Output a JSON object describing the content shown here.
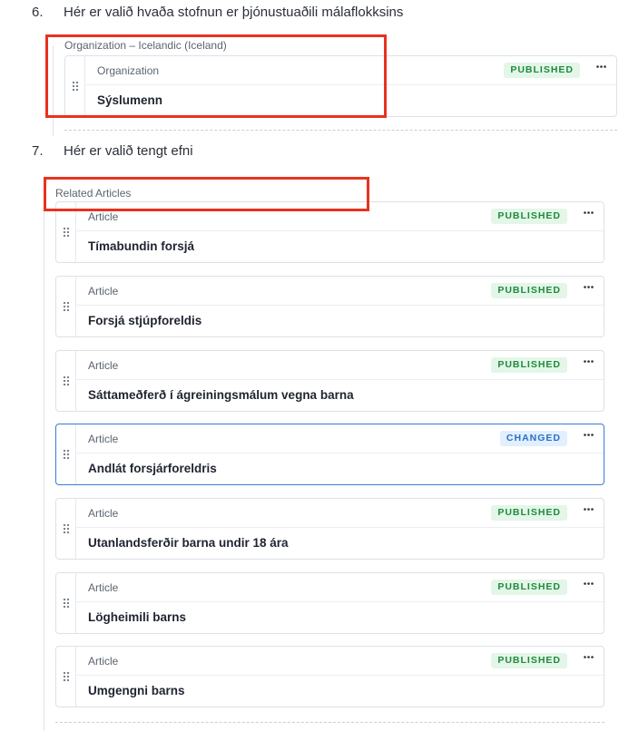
{
  "steps": [
    {
      "number": "6.",
      "text": "Hér er valið hvaða stofnun er þjónustuaðili málaflokksins"
    },
    {
      "number": "7.",
      "text": "Hér er valið tengt efni"
    }
  ],
  "organization_section": {
    "title": "Organization – Icelandic (Iceland)",
    "card": {
      "type": "Organization",
      "status": "PUBLISHED",
      "name": "Sýslumenn"
    }
  },
  "related_section": {
    "title": "Related Articles",
    "cards": [
      {
        "type": "Article",
        "status": "PUBLISHED",
        "name": "Tímabundin forsjá"
      },
      {
        "type": "Article",
        "status": "PUBLISHED",
        "name": "Forsjá stjúpforeldis"
      },
      {
        "type": "Article",
        "status": "PUBLISHED",
        "name": "Sáttameðferð í ágreiningsmálum vegna barna"
      },
      {
        "type": "Article",
        "status": "CHANGED",
        "name": "Andlát forsjárforeldris"
      },
      {
        "type": "Article",
        "status": "PUBLISHED",
        "name": "Utanlandsferðir barna undir 18 ára"
      },
      {
        "type": "Article",
        "status": "PUBLISHED",
        "name": "Lögheimili barns"
      },
      {
        "type": "Article",
        "status": "PUBLISHED",
        "name": "Umgengni barns"
      }
    ]
  },
  "icons": {
    "drag": "drag-handle-icon",
    "menu": "more-options-icon"
  },
  "colors": {
    "highlight": "#e8321e",
    "published_bg": "#e3f6e8",
    "published_fg": "#1f8a3c",
    "changed_bg": "#e1efff",
    "changed_fg": "#2a6fc9",
    "changed_border": "#3a7bd5"
  }
}
